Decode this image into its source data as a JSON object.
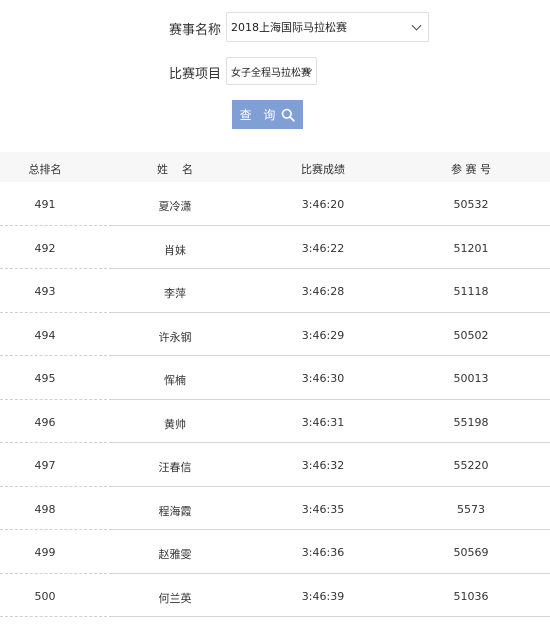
{
  "form": {
    "event_label": "赛事名称",
    "event_value": "2018上海国际马拉松赛",
    "category_label": "比赛项目",
    "category_value": "女子全程马拉松赛",
    "query_label": "查 询"
  },
  "table": {
    "headers": {
      "rank": "总排名",
      "name": "姓    名",
      "result": "比赛成绩",
      "bib": "参 赛 号"
    },
    "rows": [
      {
        "rank": "491",
        "name": "夏冷潇",
        "result": "3:46:20",
        "bib": "50532"
      },
      {
        "rank": "492",
        "name": "肖妹",
        "result": "3:46:22",
        "bib": "51201"
      },
      {
        "rank": "493",
        "name": "李萍",
        "result": "3:46:28",
        "bib": "51118"
      },
      {
        "rank": "494",
        "name": "许永钢",
        "result": "3:46:29",
        "bib": "50502"
      },
      {
        "rank": "495",
        "name": "恽楠",
        "result": "3:46:30",
        "bib": "50013"
      },
      {
        "rank": "496",
        "name": "黄帅",
        "result": "3:46:31",
        "bib": "55198"
      },
      {
        "rank": "497",
        "name": "汪春信",
        "result": "3:46:32",
        "bib": "55220"
      },
      {
        "rank": "498",
        "name": "程海霞",
        "result": "3:46:35",
        "bib": "5573"
      },
      {
        "rank": "499",
        "name": "赵雅雯",
        "result": "3:46:36",
        "bib": "50569"
      },
      {
        "rank": "500",
        "name": "何兰英",
        "result": "3:46:39",
        "bib": "51036"
      }
    ]
  },
  "icons": {
    "query": "search-icon",
    "select_arrow": "chevron-down-icon"
  },
  "colors": {
    "query_button": "#7f9fd5",
    "header_background": "#f7f7f7"
  }
}
